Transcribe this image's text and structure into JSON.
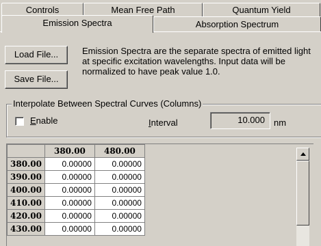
{
  "tabs": {
    "row1": [
      "Controls",
      "Mean Free Path",
      "Quantum Yield"
    ],
    "row2": [
      "Emission Spectra",
      "Absorption Spectrum"
    ],
    "active": "Emission Spectra"
  },
  "buttons": {
    "load": "Load File...",
    "save": "Save File..."
  },
  "description": {
    "line1": "Emission Spectra are the separate spectra of emitted light",
    "line2": "at specific excitation wavelengths. Input data will be",
    "line3": "normalized to have peak value 1.0."
  },
  "interpolate": {
    "group_label": "Interpolate Between Spectral Curves (Columns)",
    "enable_label": "Enable",
    "enabled": false,
    "interval_label": "Interval",
    "interval_value": "10.000",
    "interval_unit": "nm"
  },
  "grid": {
    "columns": [
      "380.00",
      "480.00"
    ],
    "rows": [
      {
        "header": "380.00",
        "values": [
          "0.00000",
          "0.00000"
        ]
      },
      {
        "header": "390.00",
        "values": [
          "0.00000",
          "0.00000"
        ]
      },
      {
        "header": "400.00",
        "values": [
          "0.00000",
          "0.00000"
        ]
      },
      {
        "header": "410.00",
        "values": [
          "0.00000",
          "0.00000"
        ]
      },
      {
        "header": "420.00",
        "values": [
          "0.00000",
          "0.00000"
        ]
      },
      {
        "header": "430.00",
        "values": [
          "0.00000",
          "0.00000"
        ]
      }
    ]
  }
}
